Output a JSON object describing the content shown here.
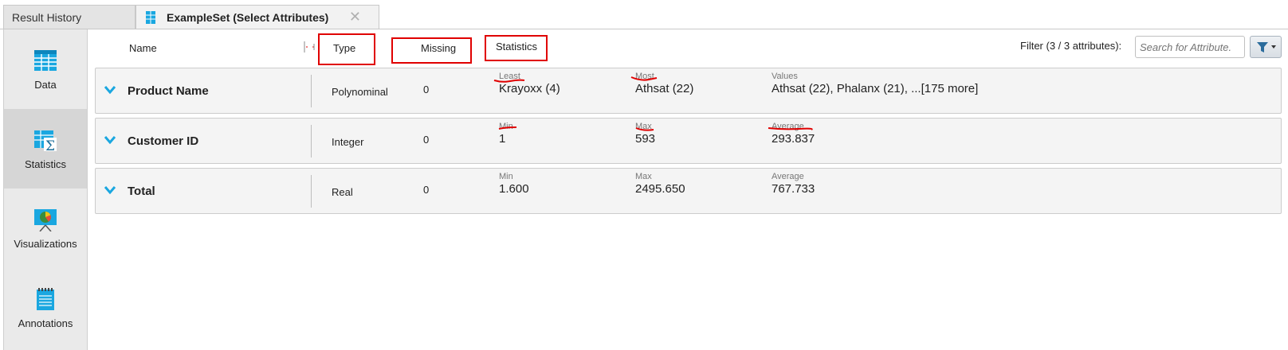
{
  "tabs": [
    {
      "label": "Result History"
    },
    {
      "label": "ExampleSet (Select Attributes)",
      "close": "✕"
    }
  ],
  "sidebar": {
    "items": [
      {
        "label": "Data",
        "icon": "table-icon"
      },
      {
        "label": "Statistics",
        "icon": "statistics-icon",
        "active": true
      },
      {
        "label": "Visualizations",
        "icon": "chart-board-icon"
      },
      {
        "label": "Annotations",
        "icon": "notepad-icon"
      }
    ]
  },
  "header": {
    "name": "Name",
    "type": "Type",
    "missing": "Missing",
    "statistics": "Statistics",
    "filter_label": "Filter (3 / 3 attributes):",
    "search_placeholder": "Search for Attribute."
  },
  "rows": [
    {
      "name": "Product Name",
      "type": "Polynominal",
      "missing": "0",
      "stat1_label": "Least",
      "stat1_value": "Krayoxx (4)",
      "stat2_label": "Most",
      "stat2_value": "Athsat (22)",
      "stat3_label": "Values",
      "stat3_value": "Athsat (22), Phalanx (21), ...[175 more]"
    },
    {
      "name": "Customer ID",
      "type": "Integer",
      "missing": "0",
      "stat1_label": "Min",
      "stat1_value": "1",
      "stat2_label": "Max",
      "stat2_value": "593",
      "stat3_label": "Average",
      "stat3_value": "293.837"
    },
    {
      "name": "Total",
      "type": "Real",
      "missing": "0",
      "stat1_label": "Min",
      "stat1_value": "1.600",
      "stat2_label": "Max",
      "stat2_value": "2495.650",
      "stat3_label": "Average",
      "stat3_value": "767.733"
    }
  ],
  "colors": {
    "accent": "#1aa7e0",
    "annotation_red": "#e00000"
  }
}
